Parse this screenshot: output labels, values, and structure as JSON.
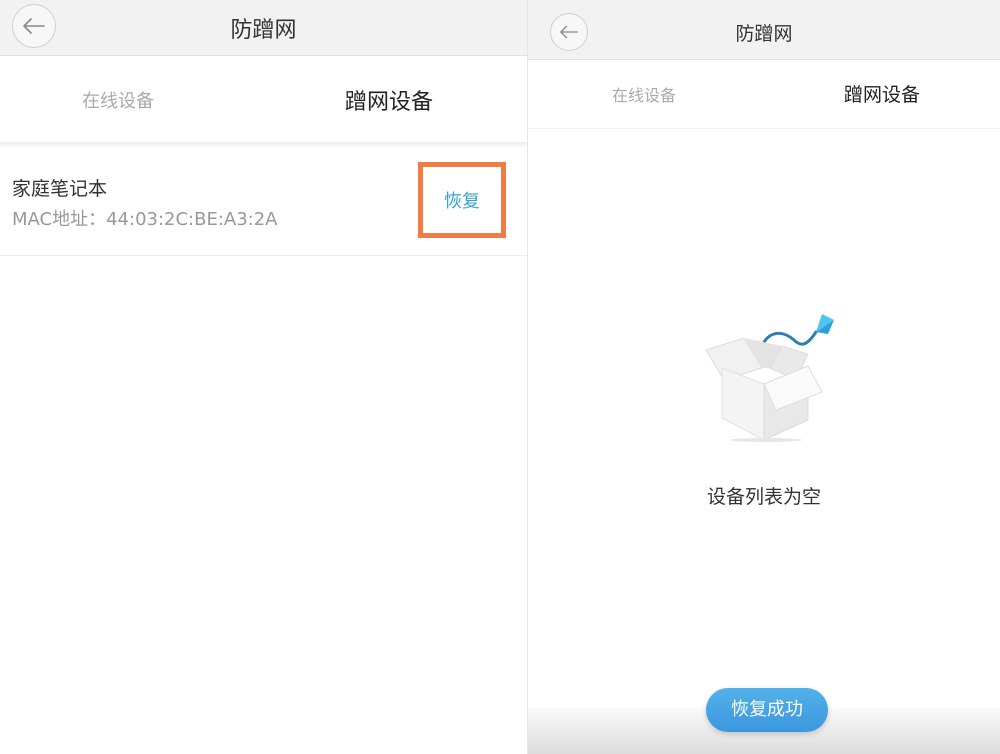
{
  "left_screen": {
    "header": {
      "title": "防蹭网"
    },
    "tabs": [
      {
        "label": "在线设备",
        "active": false
      },
      {
        "label": "蹭网设备",
        "active": true
      }
    ],
    "device": {
      "name": "家庭笔记本",
      "mac": "MAC地址：44:03:2C:BE:A3:2A",
      "restore_label": "恢复"
    },
    "highlight_color": "#ef7b45",
    "accent_color": "#3aa3d2"
  },
  "right_screen": {
    "header": {
      "title": "防蹭网"
    },
    "tabs": [
      {
        "label": "在线设备",
        "active": false
      },
      {
        "label": "蹭网设备",
        "active": true
      }
    ],
    "empty_message": "设备列表为空",
    "toast": "恢复成功",
    "illustration": "empty-box-with-kite-icon",
    "toast_color": "#3c97de"
  }
}
